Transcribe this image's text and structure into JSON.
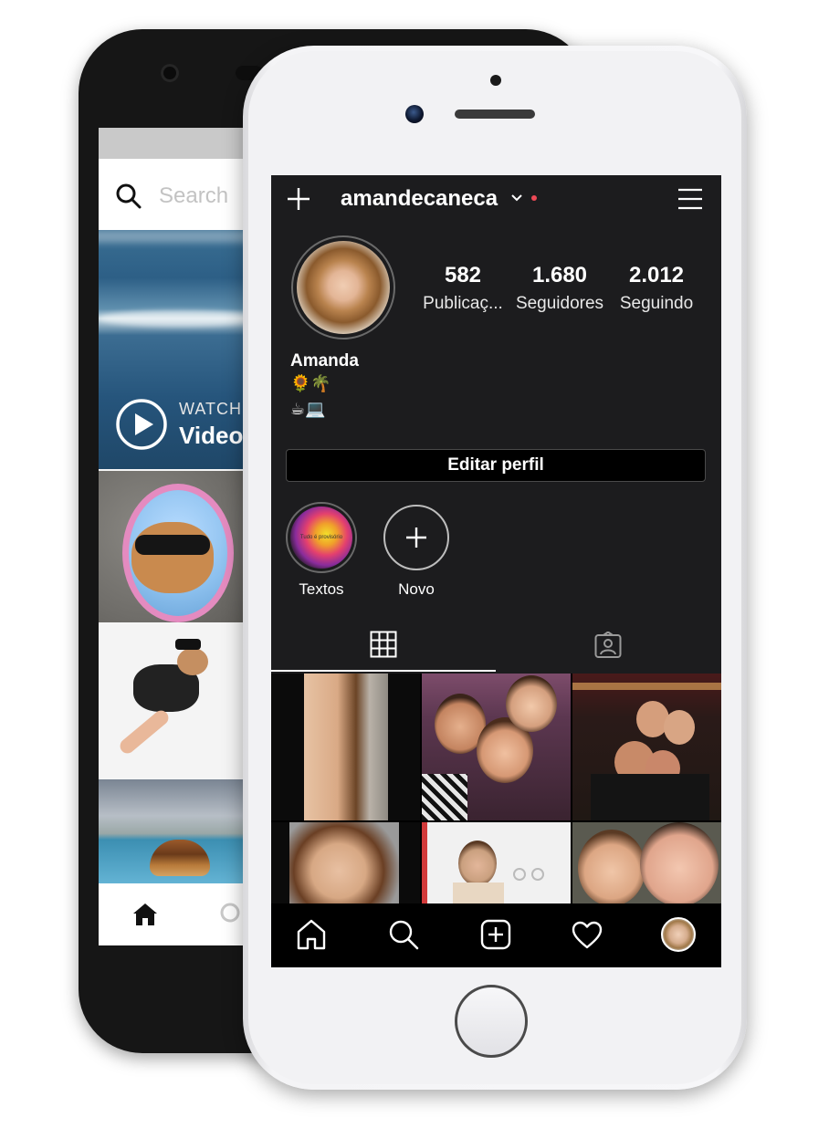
{
  "back_app": {
    "search_placeholder": "Search",
    "watch_label": "WATCH",
    "video_label": "Video"
  },
  "profile": {
    "username": "amandecaneca",
    "stats": [
      {
        "value": "582",
        "label": "Publicaç..."
      },
      {
        "value": "1.680",
        "label": "Seguidores"
      },
      {
        "value": "2.012",
        "label": "Seguindo"
      }
    ],
    "display_name": "Amanda",
    "bio_line1": "🌻🌴",
    "bio_line2": "☕💻",
    "edit_button_label": "Editar perfil",
    "highlights": [
      {
        "label": "Textos",
        "cover_text": "Tudo é provisório"
      },
      {
        "label": "Novo"
      }
    ]
  },
  "icons": {
    "top": [
      "plus-icon",
      "chevron-down-icon",
      "notification-dot",
      "menu-icon"
    ],
    "tabs": [
      "grid-icon",
      "tagged-icon"
    ],
    "bottom_nav": [
      "home-icon",
      "search-icon",
      "add-post-icon",
      "heart-icon",
      "profile-avatar"
    ]
  },
  "colors": {
    "screen_bg": "#1c1c1e",
    "notification_dot": "#ed4956",
    "text": "#ffffff"
  }
}
